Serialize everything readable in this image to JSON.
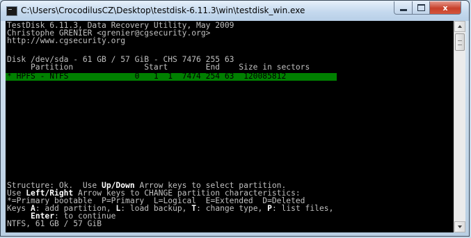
{
  "window": {
    "title": "C:\\Users\\CrocodilusCZ\\Desktop\\testdisk-6.11.3\\win\\testdisk_win.exe",
    "controls": {
      "minimize": "",
      "maximize": "",
      "close": "x"
    }
  },
  "console": {
    "header": [
      "TestDisk 6.11.3, Data Recovery Utility, May 2009",
      "Christophe GRENIER <grenier@cgsecurity.org>",
      "http://www.cgsecurity.org"
    ],
    "disk_line": "Disk /dev/sda - 61 GB / 57 GiB - CHS 7476 255 63",
    "column_headers": "     Partition               Start        End    Size in sectors",
    "selected_row": "* HPFS - NTFS              0   1  1  7474 254 63  120085812",
    "footer": {
      "l1_a": "Structure: Ok.  Use ",
      "l1_b": "Up/Down",
      "l1_c": " Arrow keys to select partition.",
      "l2_a": "Use ",
      "l2_b": "Left/Right",
      "l2_c": " Arrow keys to CHANGE partition characteristics:",
      "l3": "*=Primary bootable  P=Primary  L=Logical  E=Extended  D=Deleted",
      "l4_a": "Keys ",
      "l4_b": "A",
      "l4_c": ": add partition, ",
      "l4_d": "L",
      "l4_e": ": load backup, ",
      "l4_f": "T",
      "l4_g": ": change type, ",
      "l4_h": "P",
      "l4_i": ": list files,",
      "l5_a": "     ",
      "l5_b": "Enter",
      "l5_c": ": to continue",
      "l6": "NTFS, 61 GB / 57 GiB"
    }
  },
  "colors": {
    "console_bg": "#000000",
    "console_text": "#c0c0c0",
    "highlight_text": "#ffffff",
    "selection_bg": "#008000"
  }
}
